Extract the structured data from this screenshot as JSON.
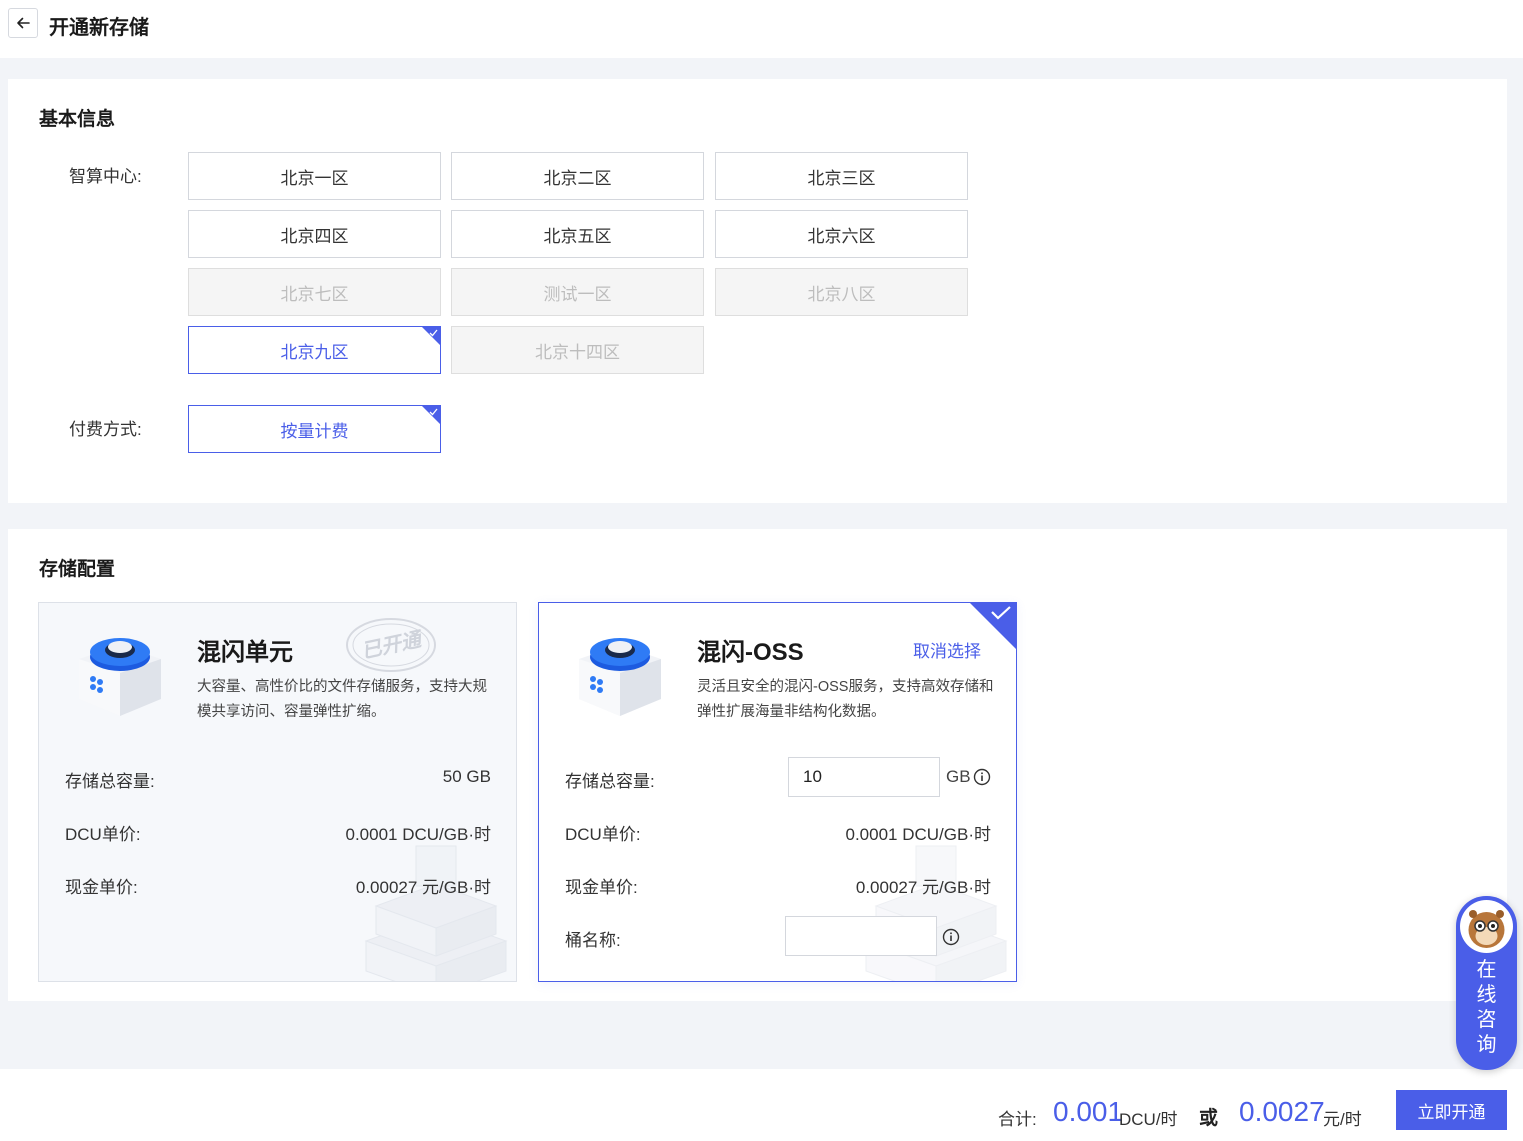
{
  "header": {
    "title": "开通新存储"
  },
  "basic": {
    "title": "基本信息",
    "zone_label": "智算中心:",
    "zones": [
      {
        "label": "北京一区",
        "state": "normal"
      },
      {
        "label": "北京二区",
        "state": "normal"
      },
      {
        "label": "北京三区",
        "state": "normal"
      },
      {
        "label": "北京四区",
        "state": "normal"
      },
      {
        "label": "北京五区",
        "state": "normal"
      },
      {
        "label": "北京六区",
        "state": "normal"
      },
      {
        "label": "北京七区",
        "state": "disabled"
      },
      {
        "label": "测试一区",
        "state": "disabled"
      },
      {
        "label": "北京八区",
        "state": "disabled"
      },
      {
        "label": "北京九区",
        "state": "selected"
      },
      {
        "label": "北京十四区",
        "state": "disabled"
      }
    ],
    "pay_label": "付费方式:",
    "pay_option": "按量计费"
  },
  "storage": {
    "title": "存储配置",
    "products": [
      {
        "name": "混闪单元",
        "desc": "大容量、高性价比的文件存储服务，支持大规模共享访问、容量弹性扩缩。",
        "stamp": "已开通",
        "capacity_label": "存储总容量:",
        "capacity": "50 GB",
        "dcu_label": "DCU单价:",
        "dcu_price": "0.0001 DCU/GB·时",
        "cash_label": "现金单价:",
        "cash_price": "0.00027 元/GB·时"
      },
      {
        "name": "混闪-OSS",
        "cancel": "取消选择",
        "desc": "灵活且安全的混闪-OSS服务，支持高效存储和弹性扩展海量非结构化数据。",
        "capacity_label": "存储总容量:",
        "capacity_value": "10",
        "capacity_unit": "GB",
        "dcu_label": "DCU单价:",
        "dcu_price": "0.0001 DCU/GB·时",
        "cash_label": "现金单价:",
        "cash_price": "0.00027 元/GB·时",
        "bucket_label": "桶名称:",
        "bucket_value": ""
      }
    ]
  },
  "footer": {
    "total_label": "合计:",
    "dcu_total": "0.001",
    "dcu_unit": "DCU/时",
    "or": "或",
    "cash_total": "0.0027",
    "cash_unit": "元/时",
    "submit": "立即开通"
  },
  "consult": {
    "label": "在线咨询"
  },
  "colors": {
    "accent": "#4a5ee8",
    "disabled_bg": "#f5f5f5",
    "page_bg": "#f2f4f8"
  }
}
